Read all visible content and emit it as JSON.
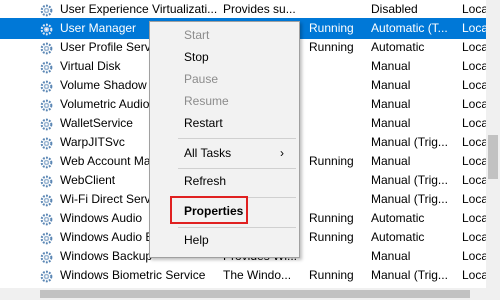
{
  "services": [
    {
      "name": "User Experience Virtualizati...",
      "description": "Provides su...",
      "status": "",
      "startup": "Disabled",
      "logon": "Loca",
      "selected": false
    },
    {
      "name": "User Manager",
      "description": "",
      "status": "Running",
      "startup": "Automatic (T...",
      "logon": "Loca",
      "selected": true
    },
    {
      "name": "User Profile Servic",
      "description": "",
      "status": "Running",
      "startup": "Automatic",
      "logon": "Loca",
      "selected": false
    },
    {
      "name": "Virtual Disk",
      "description": "",
      "status": "",
      "startup": "Manual",
      "logon": "Loca",
      "selected": false
    },
    {
      "name": "Volume Shadow C",
      "description": "",
      "status": "",
      "startup": "Manual",
      "logon": "Loca",
      "selected": false
    },
    {
      "name": "Volumetric Audio",
      "description": "",
      "status": "",
      "startup": "Manual",
      "logon": "Loca",
      "selected": false
    },
    {
      "name": "WalletService",
      "description": "",
      "status": "",
      "startup": "Manual",
      "logon": "Loca",
      "selected": false
    },
    {
      "name": "WarpJITSvc",
      "description": "",
      "status": "",
      "startup": "Manual (Trig...",
      "logon": "Loca",
      "selected": false
    },
    {
      "name": "Web Account Ma",
      "description": "",
      "status": "Running",
      "startup": "Manual",
      "logon": "Loca",
      "selected": false
    },
    {
      "name": "WebClient",
      "description": "",
      "status": "",
      "startup": "Manual (Trig...",
      "logon": "Loca",
      "selected": false
    },
    {
      "name": "Wi-Fi Direct Servi",
      "description": "",
      "status": "",
      "startup": "Manual (Trig...",
      "logon": "Loca",
      "selected": false
    },
    {
      "name": "Windows Audio",
      "description": "",
      "status": "Running",
      "startup": "Automatic",
      "logon": "Loca",
      "selected": false
    },
    {
      "name": "Windows Audio E",
      "description": "",
      "status": "Running",
      "startup": "Automatic",
      "logon": "Loca",
      "selected": false
    },
    {
      "name": "Windows Backup",
      "description": "Provides Wi...",
      "status": "",
      "startup": "Manual",
      "logon": "Loca",
      "selected": false
    },
    {
      "name": "Windows Biometric Service",
      "description": "The Windo...",
      "status": "Running",
      "startup": "Manual (Trig...",
      "logon": "Loca",
      "selected": false
    }
  ],
  "context_menu": {
    "start": "Start",
    "stop": "Stop",
    "pause": "Pause",
    "resume": "Resume",
    "restart": "Restart",
    "all_tasks": "All Tasks",
    "submenu_arrow": "›",
    "refresh": "Refresh",
    "properties": "Properties",
    "help": "Help"
  },
  "icons": {
    "service": "gear-icon"
  },
  "colors": {
    "selection": "#0078d7",
    "highlight_box": "#e02020"
  }
}
